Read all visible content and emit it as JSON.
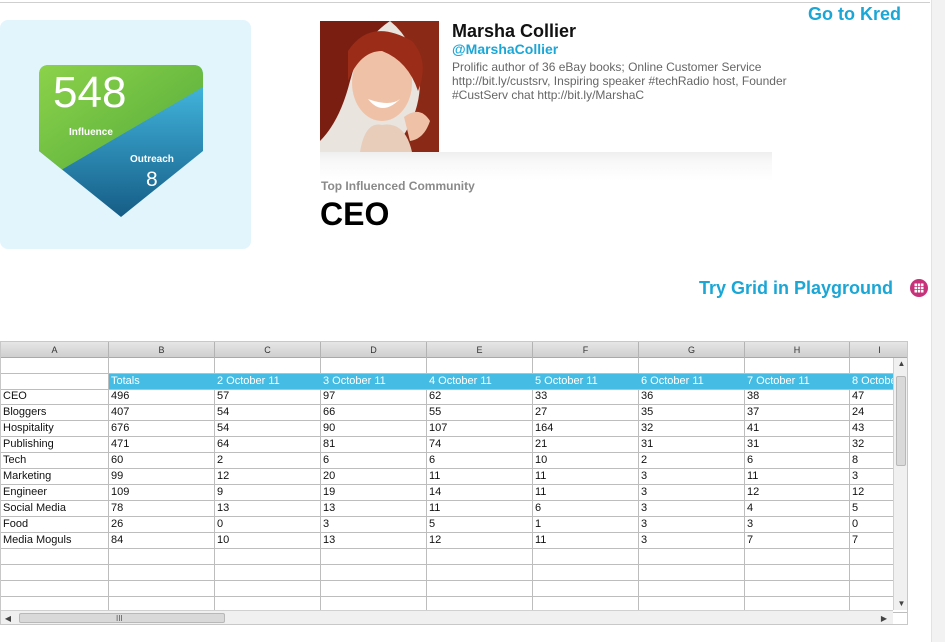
{
  "links": {
    "go_to_kred": "Go to Kred",
    "try_grid": "Try Grid in Playground"
  },
  "score": {
    "influence_value": "548",
    "influence_label": "Influence",
    "outreach_label": "Outreach",
    "outreach_value": "8",
    "colors": {
      "influence": "#6cc04a",
      "outreach": "#1b8fc0",
      "card_bg": "#e3f5fc"
    }
  },
  "profile": {
    "name": "Marsha Collier",
    "handle": "@MarshaCollier",
    "bio": "Prolific author of 36 eBay books; Online Customer Service http://bit.ly/custsrv, Inspiring speaker #techRadio host, Founder #CustServ chat http://bit.ly/MarshaC"
  },
  "community": {
    "label": "Top Influenced Community",
    "value": "CEO"
  },
  "sheet": {
    "columns": [
      "A",
      "B",
      "C",
      "D",
      "E",
      "F",
      "G",
      "H",
      "I"
    ],
    "header_row": [
      "",
      "Totals",
      "2 October 11",
      "3 October 11",
      "4 October 11",
      "5 October 11",
      "6 October 11",
      "7 October 11",
      "8 Octobe"
    ],
    "rows": [
      [
        "CEO",
        "496",
        "57",
        "97",
        "62",
        "33",
        "36",
        "38",
        "47"
      ],
      [
        "Bloggers",
        "407",
        "54",
        "66",
        "55",
        "27",
        "35",
        "37",
        "24"
      ],
      [
        "Hospitality",
        "676",
        "54",
        "90",
        "107",
        "164",
        "32",
        "41",
        "43"
      ],
      [
        "Publishing",
        "471",
        "64",
        "81",
        "74",
        "21",
        "31",
        "31",
        "32"
      ],
      [
        "Tech",
        "60",
        "2",
        "6",
        "6",
        "10",
        "2",
        "6",
        "8"
      ],
      [
        "Marketing",
        "99",
        "12",
        "20",
        "11",
        "11",
        "3",
        "11",
        "3"
      ],
      [
        "Engineer",
        "109",
        "9",
        "19",
        "14",
        "11",
        "3",
        "12",
        "12"
      ],
      [
        "Social Media",
        "78",
        "13",
        "13",
        "11",
        "6",
        "3",
        "4",
        "5"
      ],
      [
        "Food",
        "26",
        "0",
        "3",
        "5",
        "1",
        "3",
        "3",
        "0"
      ],
      [
        "Media Moguls",
        "84",
        "10",
        "13",
        "12",
        "11",
        "3",
        "7",
        "7"
      ]
    ],
    "header_color": "#45bce3",
    "scroll_grip": "III"
  }
}
